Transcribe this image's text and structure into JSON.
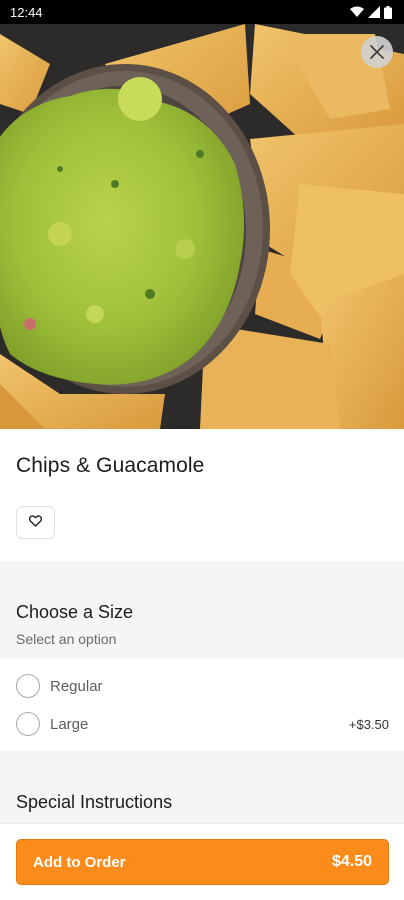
{
  "status_bar": {
    "time": "12:44"
  },
  "item": {
    "title": "Chips & Guacamole"
  },
  "size_section": {
    "title": "Choose a Size",
    "subtitle": "Select an option",
    "options": [
      {
        "label": "Regular",
        "price": ""
      },
      {
        "label": "Large",
        "price": "+$3.50"
      }
    ]
  },
  "instructions_section": {
    "title": "Special Instructions"
  },
  "bottom_bar": {
    "button_label": "Add to Order",
    "price": "$4.50"
  },
  "colors": {
    "accent": "#fb8c1c",
    "guacamole": "#a3c23c",
    "chip": "#e9b45a"
  },
  "icons": [
    "wifi-icon",
    "signal-icon",
    "battery-icon",
    "close-icon",
    "heart-icon"
  ]
}
